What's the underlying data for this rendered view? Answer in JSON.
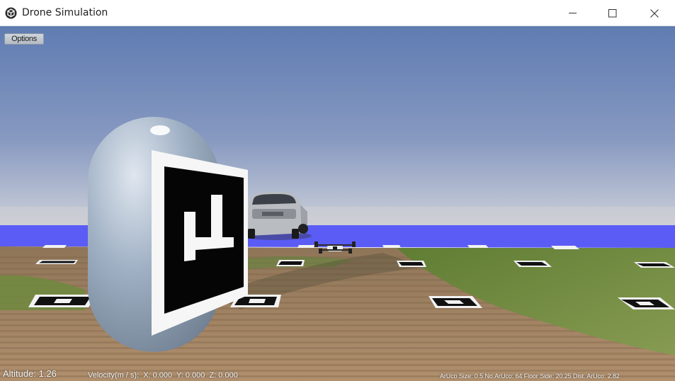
{
  "window": {
    "title": "Drone Simulation",
    "minimize_icon": "minimize-icon",
    "maximize_icon": "maximize-icon",
    "close_icon": "close-icon",
    "app_icon": "unity-cube-icon"
  },
  "toolbar": {
    "options_label": "Options"
  },
  "hud": {
    "altitude_label": "Altitude:",
    "altitude_value": "1.26",
    "velocity_label": "Velocity(m / s):",
    "vx": "X: 0.000",
    "vy": "Y: 0.000",
    "vz": "Z: 0.000",
    "aruco_size": "ArUco Size: 0.5",
    "aruco_count": "No.ArUco: 64",
    "floor_side": "Floor Side: 20.25",
    "aruco_dist": "Dist. ArUco: 2.82"
  },
  "colors": {
    "sky_top": "#5e7bb3",
    "sky_horizon": "#c7ccd7",
    "water": "#5b5cf5",
    "dirt": "#a28161",
    "grass": "#6d8a3e"
  }
}
